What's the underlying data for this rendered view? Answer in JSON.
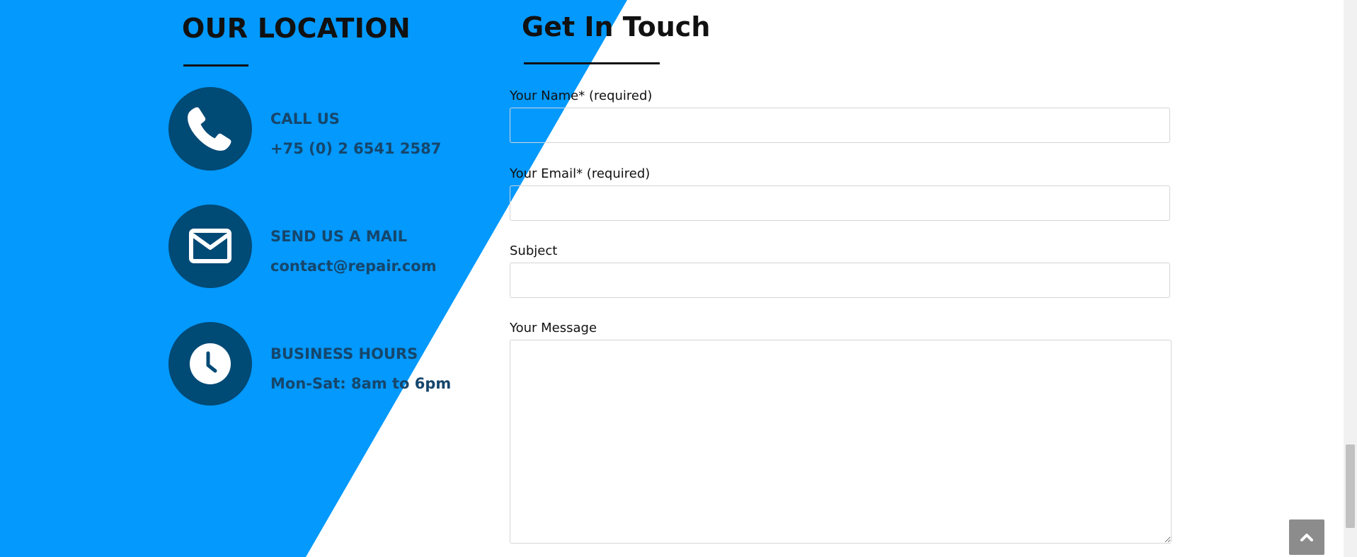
{
  "colors": {
    "accent_blue": "#0399fd",
    "icon_circle": "#004a76",
    "info_text": "#16466b",
    "heading": "#111111",
    "scroll_top_button": "#8c8c8c"
  },
  "location": {
    "title": "OUR LOCATION",
    "items": [
      {
        "icon": "phone-icon",
        "label": "CALL US",
        "value": "+75 (0) 2 6541 2587"
      },
      {
        "icon": "mail-icon",
        "label": "SEND US A MAIL",
        "value": "contact@repair.com"
      },
      {
        "icon": "clock-icon",
        "label": "BUSINESS HOURS",
        "value": "Mon-Sat: 8am to 6pm"
      }
    ]
  },
  "contact": {
    "title": "Get In Touch",
    "fields": {
      "name": {
        "label": "Your Name* (required)",
        "value": ""
      },
      "email": {
        "label": "Your Email* (required)",
        "value": ""
      },
      "subject": {
        "label": "Subject",
        "value": ""
      },
      "message": {
        "label": "Your Message",
        "value": ""
      }
    }
  },
  "scroll_top": {
    "icon": "chevron-up-icon"
  }
}
